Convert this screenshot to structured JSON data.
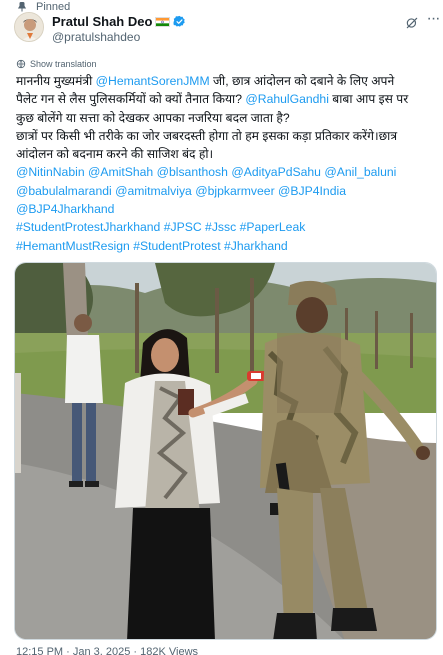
{
  "pinned": {
    "label": "Pinned"
  },
  "author": {
    "display_name": "Pratul Shah Deo",
    "handle": "@pratulshahdeo",
    "flag_icon": "india-flag-icon",
    "verified_icon": "verified-badge-icon"
  },
  "translate": {
    "label": "Show translation"
  },
  "tweet": {
    "lines": [
      [
        {
          "t": "माननीय मुख्यमंत्री "
        },
        {
          "t": "@HemantSorenJMM",
          "m": true
        },
        {
          "t": " जी, छात्र आंदोलन को दबाने के लिए अपने"
        }
      ],
      [
        {
          "t": "पैलेट गन से लैस पुलिसकर्मियों को क्यों तैनात किया? "
        },
        {
          "t": "@RahulGandhi",
          "m": true
        },
        {
          "t": " बाबा आप इस पर"
        }
      ],
      [
        {
          "t": "कुछ बोलेंगे या सत्ता को देखकर आपका नजरिया बदल जाता है?"
        }
      ],
      [
        {
          "t": "छात्रों पर किसी भी तरीके का जोर जबरदस्ती होगा तो हम इसका कड़ा प्रतिकार करेंगे।छात्र"
        }
      ],
      [
        {
          "t": "आंदोलन को बदनाम करने की साजिश बंद हो।"
        }
      ],
      [
        {
          "t": "@NitinNabin",
          "m": true
        },
        {
          "t": " "
        },
        {
          "t": "@AmitShah",
          "m": true
        },
        {
          "t": " "
        },
        {
          "t": "@blsanthosh",
          "m": true
        },
        {
          "t": " "
        },
        {
          "t": "@AdityaPdSahu",
          "m": true
        },
        {
          "t": " "
        },
        {
          "t": "@Anil_baluni",
          "m": true
        }
      ],
      [
        {
          "t": "@babulalmarandi",
          "m": true
        },
        {
          "t": " "
        },
        {
          "t": "@amitmalviya",
          "m": true
        },
        {
          "t": " "
        },
        {
          "t": "@bjpkarmveer",
          "m": true
        },
        {
          "t": " "
        },
        {
          "t": "@BJP4India",
          "m": true
        }
      ],
      [
        {
          "t": "@BJP4Jharkhand",
          "m": true
        }
      ],
      [
        {
          "t": "#StudentProtestJharkhand",
          "m": true
        },
        {
          "t": " "
        },
        {
          "t": "#JPSC",
          "m": true
        },
        {
          "t": " "
        },
        {
          "t": "#Jssc",
          "m": true
        },
        {
          "t": " "
        },
        {
          "t": "#PaperLeak",
          "m": true
        }
      ],
      [
        {
          "t": "#HemantMustResign",
          "m": true
        },
        {
          "t": " "
        },
        {
          "t": "#StudentProtest",
          "m": true
        },
        {
          "t": " "
        },
        {
          "t": "#Jharkhand",
          "m": true
        }
      ]
    ]
  },
  "media": {
    "type": "video-still",
    "description_icon": "video-thumbnail"
  },
  "footer": {
    "partial_text": "12:15 PM · Jan 3, 2025 · 182K Views"
  },
  "colors": {
    "link": "#1d9bf0",
    "text": "#0f1419",
    "muted": "#536471"
  }
}
